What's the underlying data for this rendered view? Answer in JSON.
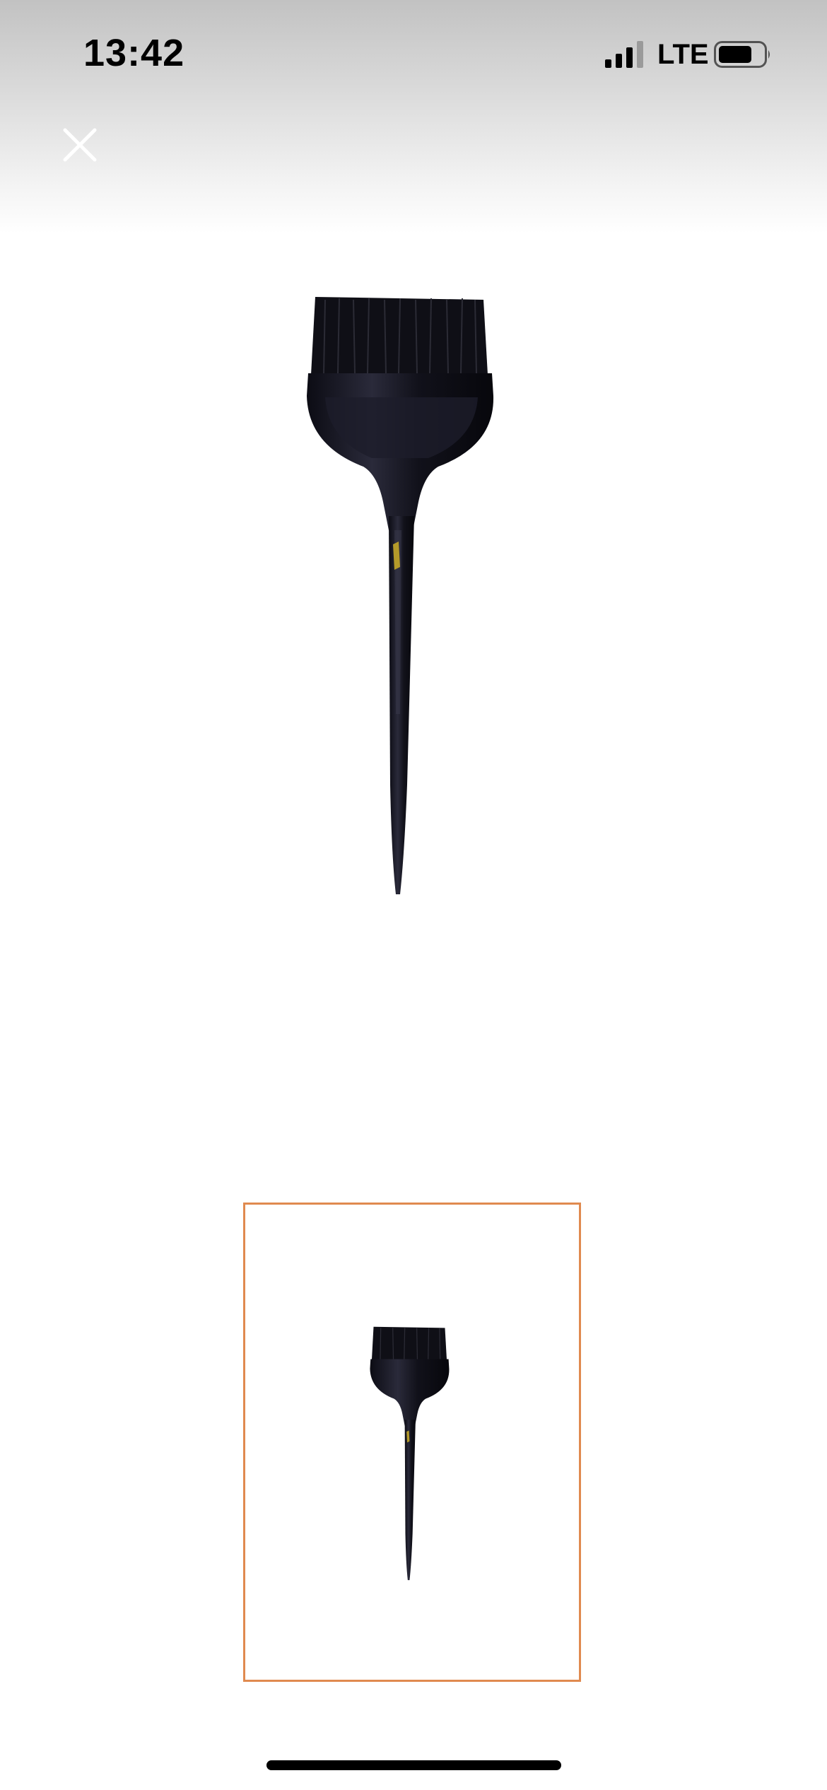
{
  "status_bar": {
    "time": "13:42",
    "network": "LTE",
    "signal_icon": "signal-bars-icon",
    "battery_icon": "battery-icon"
  },
  "viewer": {
    "close_icon": "close-icon",
    "main_image": "tint-brush-image",
    "selected_thumbnail_index": 1,
    "thumbnail_count": 1,
    "thumbnail_border_color": "#e08a4f"
  },
  "colors": {
    "brush": "#15151f",
    "logo_accent": "#b49a2a",
    "top_gradient_start": "#c2c2c2"
  }
}
